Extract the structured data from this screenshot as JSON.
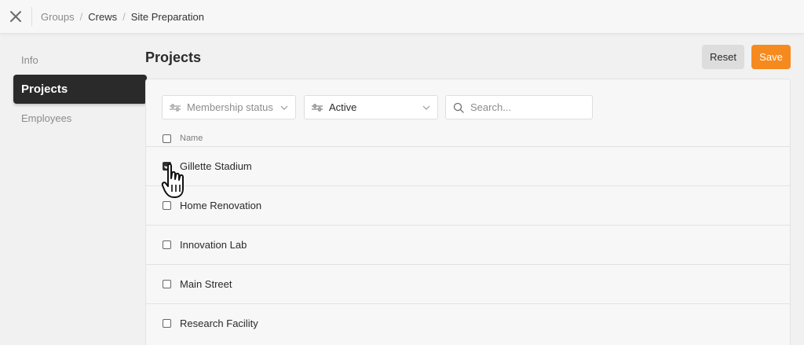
{
  "breadcrumb": {
    "items": [
      "Groups",
      "Crews",
      "Site Preparation"
    ],
    "separator": "/"
  },
  "sidebar": {
    "items": [
      {
        "label": "Info",
        "active": false
      },
      {
        "label": "Projects",
        "active": true
      },
      {
        "label": "Employees",
        "active": false
      }
    ]
  },
  "header": {
    "title": "Projects",
    "reset_label": "Reset",
    "save_label": "Save"
  },
  "filters": {
    "membership_status": {
      "label": "Membership status",
      "icon": "sliders-icon"
    },
    "status": {
      "label": "Active",
      "icon": "sliders-icon"
    },
    "search": {
      "placeholder": "Search...",
      "value": "",
      "icon": "search-icon"
    }
  },
  "table": {
    "header": {
      "name_label": "Name"
    },
    "rows": [
      {
        "name": "Gillette Stadium",
        "checked": true
      },
      {
        "name": "Home Renovation",
        "checked": false
      },
      {
        "name": "Innovation Lab",
        "checked": false
      },
      {
        "name": "Main Street",
        "checked": false
      },
      {
        "name": "Research Facility",
        "checked": false
      }
    ]
  },
  "colors": {
    "accent": "#f58a1f",
    "sidebar_active_bg": "#2a2a2a",
    "page_bg": "#f1f1f1"
  }
}
